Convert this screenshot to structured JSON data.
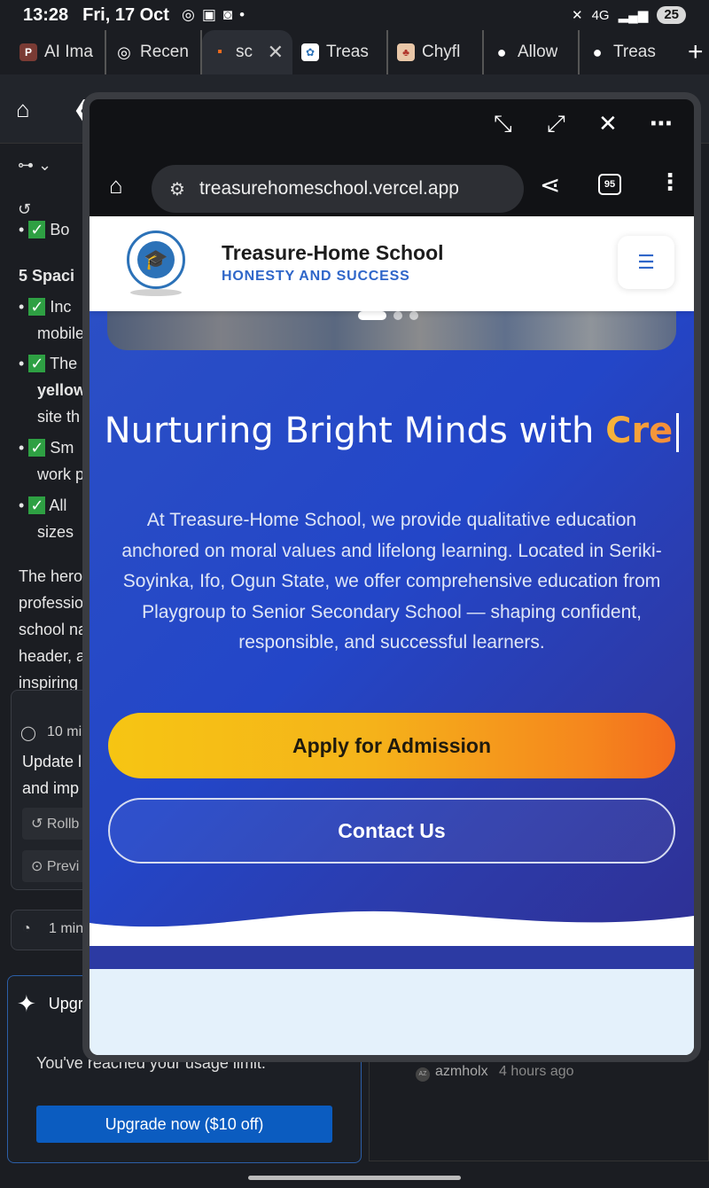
{
  "status_bar": {
    "time": "13:28",
    "date": "Fri, 17 Oct",
    "dot": "•",
    "network": "4G",
    "battery": "25"
  },
  "browser_tabs": [
    {
      "label": "AI Ima",
      "favicon": "P"
    },
    {
      "label": "Recen",
      "favicon": "◎"
    },
    {
      "label": "sc",
      "favicon": "▪",
      "active": true
    },
    {
      "label": "Treas",
      "favicon": "✿"
    },
    {
      "label": "Chyfl",
      "favicon": "♣"
    },
    {
      "label": "Allow",
      "favicon": "●"
    },
    {
      "label": "Treas",
      "favicon": "●"
    }
  ],
  "background_app": {
    "text_fragments": [
      "Bo",
      "5 Spaci",
      "Inc",
      "mobile",
      "The",
      "yellow",
      "site th",
      "Sm",
      "work p",
      "All",
      "sizes",
      "The hero",
      "professio",
      "school na",
      "header, a",
      "inspiring"
    ],
    "card_time": "10 mi",
    "card_lines": [
      "Update l",
      "and imp"
    ],
    "rollback": "Rollb",
    "preview": "Previ",
    "speed": "1 min",
    "upgrade_title": "Upgr",
    "usage_msg": "You've reached your usage limit.",
    "upgrade_button": "Upgrade now ($10 off)",
    "author": "azmholx",
    "author_initials": "AZ",
    "time_ago": "4 hours ago"
  },
  "floating_window": {
    "url": "treasurehomeschool.vercel.app",
    "tab_count": "95"
  },
  "site": {
    "school_name": "Treasure-Home School",
    "motto": "HONESTY AND SUCCESS",
    "headline_prefix": "Nurturing Bright Minds with",
    "headline_accent": "Cre",
    "intro": "At Treasure-Home School, we provide qualitative education anchored on moral values and lifelong learning. Located in Seriki-Soyinka, Ifo, Ogun State, we offer comprehensive education from Playgroup to Senior Secondary School — shaping confident, responsible, and successful learners.",
    "apply_button": "Apply for Admission",
    "contact_button": "Contact Us",
    "slides_total": 3,
    "slide_active": 1
  },
  "colors": {
    "hero_blue": "#2346c8",
    "accent_yellow": "#f6c513",
    "accent_orange": "#f36b1e",
    "brand_blue": "#2f66c9"
  }
}
